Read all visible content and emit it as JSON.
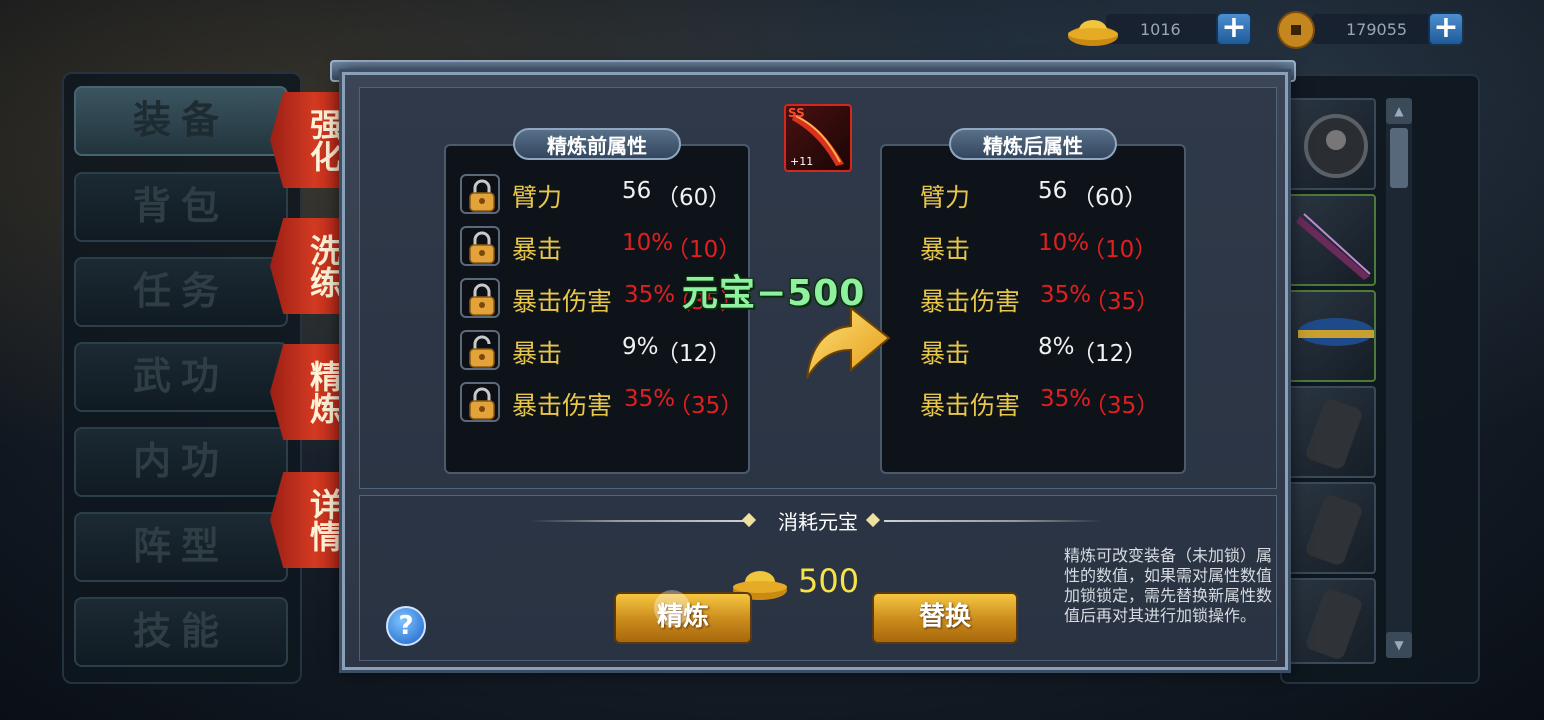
{
  "currency": {
    "ingot": "1016",
    "coin": "179055",
    "add_symbol": "+"
  },
  "menu": [
    "装备",
    "背包",
    "任务",
    "武功",
    "内功",
    "阵型",
    "技能"
  ],
  "tabs": [
    "强化",
    "洗练",
    "精炼",
    "详情"
  ],
  "before": {
    "title": "精炼前属性",
    "rows": [
      {
        "name": "臂力",
        "value": "56",
        "extra": "（60）",
        "color": "white",
        "locked": true
      },
      {
        "name": "暴击",
        "value": "10%",
        "extra": "（10）",
        "color": "red",
        "locked": true
      },
      {
        "name": "暴击伤害",
        "value": "35%",
        "extra": "（35）",
        "color": "red",
        "locked": true
      },
      {
        "name": "暴击",
        "value": "9%",
        "extra": "（12）",
        "color": "white",
        "locked": false
      },
      {
        "name": "暴击伤害",
        "value": "35%",
        "extra": "（35）",
        "color": "red",
        "locked": true
      }
    ]
  },
  "after": {
    "title": "精炼后属性",
    "rows": [
      {
        "name": "臂力",
        "value": "56",
        "extra": "（60）",
        "color": "white"
      },
      {
        "name": "暴击",
        "value": "10%",
        "extra": "（10）",
        "color": "red"
      },
      {
        "name": "暴击伤害",
        "value": "35%",
        "extra": "（35）",
        "color": "red"
      },
      {
        "name": "暴击",
        "value": "8%",
        "extra": "（12）",
        "color": "white"
      },
      {
        "name": "暴击伤害",
        "value": "35%",
        "extra": "（35）",
        "color": "red"
      }
    ]
  },
  "item": {
    "grade": "SS",
    "level": "+11"
  },
  "cost_float": "元宝−500",
  "consume": {
    "label": "消耗元宝",
    "amount": "500"
  },
  "buttons": {
    "refine": "精炼",
    "replace": "替换",
    "help": "?"
  },
  "note": "精炼可改变装备（未加锁）属性的数值，如果需对属性数值加锁锁定，需先替换新属性数值后再对其进行加锁操作。"
}
